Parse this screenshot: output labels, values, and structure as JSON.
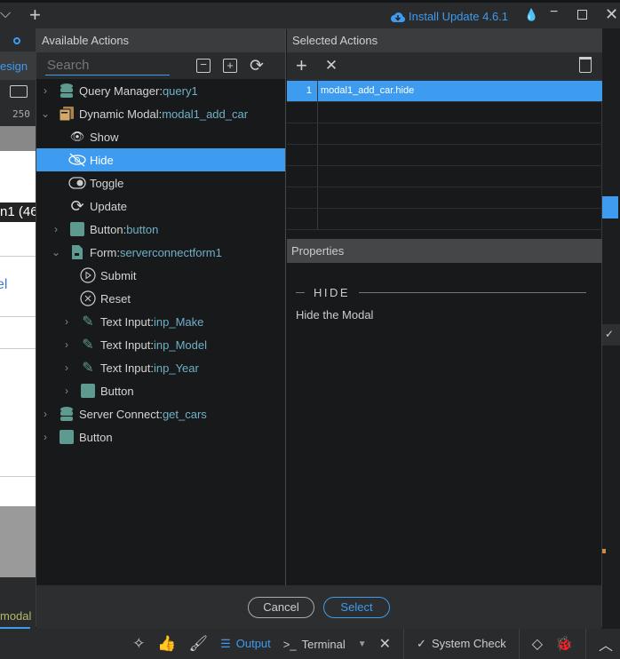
{
  "titlebar": {
    "update_label": "Install Update 4.6.1"
  },
  "background": {
    "design_tab": "esign",
    "ruler_value": "250",
    "canvas_label": "n1 (46",
    "canvas_link": "el",
    "modal_label": "modal"
  },
  "modal": {
    "left_title": "Available Actions",
    "right_title": "Selected Actions",
    "search_placeholder": "Search",
    "tree": [
      {
        "label": "Query Manager: ",
        "ref": "query1"
      },
      {
        "label": "Dynamic Modal: ",
        "ref": "modal1_add_car"
      },
      {
        "label": "Show",
        "ref": ""
      },
      {
        "label": "Hide",
        "ref": ""
      },
      {
        "label": "Toggle",
        "ref": ""
      },
      {
        "label": "Update",
        "ref": ""
      },
      {
        "label": "Button: ",
        "ref": "button"
      },
      {
        "label": "Form: ",
        "ref": "serverconnectform1"
      },
      {
        "label": "Submit",
        "ref": ""
      },
      {
        "label": "Reset",
        "ref": ""
      },
      {
        "label": "Text Input: ",
        "ref": "inp_Make"
      },
      {
        "label": "Text Input: ",
        "ref": "inp_Model"
      },
      {
        "label": "Text Input: ",
        "ref": "inp_Year"
      },
      {
        "label": "Button",
        "ref": ""
      },
      {
        "label": "Server Connect: ",
        "ref": "get_cars"
      },
      {
        "label": "Button",
        "ref": ""
      }
    ],
    "selected": [
      {
        "num": "1",
        "value": "modal1_add_car.hide"
      }
    ],
    "properties": {
      "title": "Properties",
      "section": "HIDE",
      "description": "Hide the Modal"
    },
    "cancel_label": "Cancel",
    "select_label": "Select"
  },
  "bottombar": {
    "output": "Output",
    "terminal": "Terminal",
    "system_check": "System Check"
  },
  "colors": {
    "accent": "#3d9bf0",
    "ref": "#6fb0c8",
    "component": "#5f9a90"
  }
}
